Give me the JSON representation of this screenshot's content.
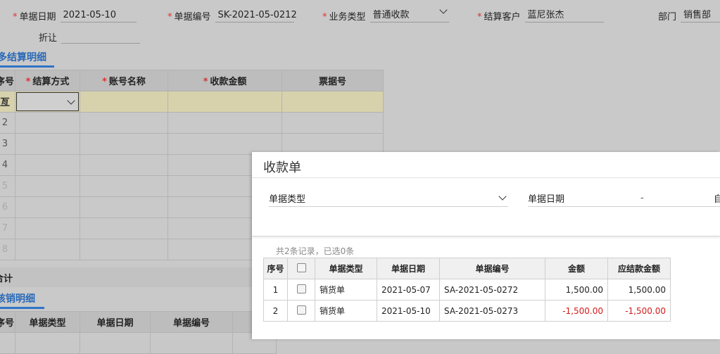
{
  "header": {
    "doc_date": {
      "label": "单据日期",
      "value": "2021-05-10"
    },
    "doc_no": {
      "label": "单据编号",
      "value": "SK-2021-05-0212"
    },
    "biz_type": {
      "label": "业务类型",
      "value": "普通收款"
    },
    "customer": {
      "label": "结算客户",
      "value": "蓝尼张杰"
    },
    "dept": {
      "label": "部门",
      "value": "销售部"
    },
    "discount": {
      "label": "折让",
      "value": ""
    }
  },
  "settle_section": {
    "tab_label": "多结算明细",
    "columns": [
      "序号",
      "结算方式",
      "账号名称",
      "收款金额",
      "票据号"
    ],
    "required": [
      false,
      true,
      true,
      true,
      false
    ],
    "rows": [
      "亙",
      "2",
      "3",
      "4",
      "5",
      "6",
      "7",
      "8"
    ]
  },
  "totals_label": "合计",
  "writeoff_section": {
    "tab_label": "核销明细",
    "columns": [
      "序号",
      "单据类型",
      "单据日期",
      "单据编号"
    ]
  },
  "dialog": {
    "title": "收款单",
    "filter_doc_type_label": "单据类型",
    "filter_date_label": "单据日期",
    "filter_date_sep": "-",
    "filter_date_tail": "自",
    "record_count": "共2条记录，已选0条",
    "columns": [
      "序号",
      "",
      "单据类型",
      "单据日期",
      "单据编号",
      "金额",
      "应结款金额"
    ],
    "rows": [
      {
        "no": "1",
        "type": "销货单",
        "date": "2021-05-07",
        "code": "SA-2021-05-0272",
        "amount": "1,500.00",
        "due": "1,500.00",
        "negative": false
      },
      {
        "no": "2",
        "type": "销货单",
        "date": "2021-05-10",
        "code": "SA-2021-05-0273",
        "amount": "-1,500.00",
        "due": "-1,500.00",
        "negative": true
      }
    ]
  },
  "colors": {
    "accent": "#2f74c8",
    "negative": "#d21a1a",
    "highlight_row": "#d7d2ac",
    "required": "#dd3333"
  }
}
